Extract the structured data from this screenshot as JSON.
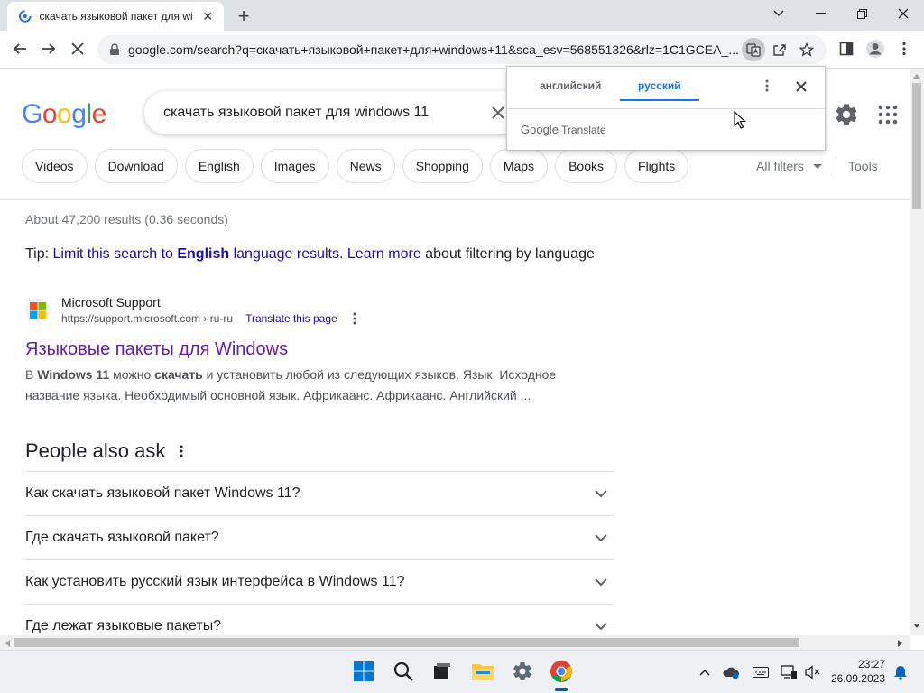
{
  "browser": {
    "tab_title": "скачать языковой пакет для wi",
    "url": "google.com/search?q=скачать+языковой+пакет+для+windows+11&sca_esv=568551326&rlz=1C1GCEA_..."
  },
  "search": {
    "query": "скачать языковой пакет для windows 11"
  },
  "logo": {
    "letters": [
      "G",
      "o",
      "o",
      "g",
      "l",
      "e"
    ],
    "colors": [
      "#4285f4",
      "#ea4335",
      "#fbbc05",
      "#4285f4",
      "#34a853",
      "#ea4335"
    ]
  },
  "chips": [
    "Videos",
    "Download",
    "English",
    "Images",
    "News",
    "Shopping",
    "Maps",
    "Books",
    "Flights"
  ],
  "filters": {
    "all_filters": "All filters",
    "tools": "Tools"
  },
  "results": {
    "stats": "About 47,200 results (0.36 seconds)",
    "tip": {
      "prefix": "Tip: ",
      "link1": "Limit this search to ",
      "bold": "English",
      "link1_end": " language results.",
      "space": " ",
      "learn_more": "Learn more",
      "suffix": " about filtering by language"
    },
    "item": {
      "site_name": "Microsoft Support",
      "cite": "https://support.microsoft.com › ru-ru",
      "translate": "Translate this page",
      "title": "Языковые пакеты для Windows",
      "snippet_parts": [
        "В ",
        "Windows 11",
        " можно ",
        "скачать",
        " и установить любой из следующих языков. Язык. Исходное название языка. Необходимый основной язык. Африкаанс. Африкаанс. Английский ..."
      ]
    }
  },
  "paa": {
    "heading": "People also ask",
    "questions": [
      "Как скачать языковой пакет Windows 11?",
      "Где скачать языковой пакет?",
      "Как установить русский язык интерфейса в Windows 11?",
      "Где лежат языковые пакеты?"
    ]
  },
  "translate_popup": {
    "lang_source": "английский",
    "lang_target": "русский",
    "brand_google": "Google",
    "brand_translate": " Translate"
  },
  "taskbar": {
    "time": "23:27",
    "date": "26.09.2023"
  },
  "colors": {
    "link": "#1a0dab",
    "visited": "#681da8",
    "accent": "#1a73e8"
  }
}
